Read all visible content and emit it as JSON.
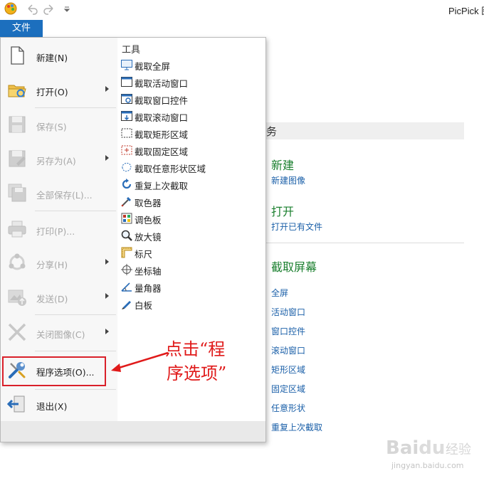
{
  "window": {
    "title": "PicPick 图"
  },
  "file_tab": {
    "label": "文件"
  },
  "menu": {
    "items": [
      {
        "label": "新建(N)",
        "enabled": true,
        "submenu": false,
        "icon": "new-file-icon"
      },
      {
        "label": "打开(O)",
        "enabled": true,
        "submenu": true,
        "icon": "open-folder-icon"
      },
      {
        "label": "保存(S)",
        "enabled": false,
        "submenu": false,
        "icon": "save-icon"
      },
      {
        "label": "另存为(A)",
        "enabled": false,
        "submenu": true,
        "icon": "save-as-icon"
      },
      {
        "label": "全部保存(L)...",
        "enabled": false,
        "submenu": false,
        "icon": "save-all-icon"
      },
      {
        "label": "打印(P)...",
        "enabled": false,
        "submenu": false,
        "icon": "print-icon"
      },
      {
        "label": "分享(H)",
        "enabled": false,
        "submenu": true,
        "icon": "share-icon"
      },
      {
        "label": "发送(D)",
        "enabled": false,
        "submenu": true,
        "icon": "send-icon"
      },
      {
        "label": "关闭图像(C)",
        "enabled": false,
        "submenu": true,
        "icon": "close-image-icon"
      },
      {
        "label": "程序选项(O)...",
        "enabled": true,
        "submenu": false,
        "icon": "wrench-icon"
      },
      {
        "label": "退出(X)",
        "enabled": true,
        "submenu": false,
        "icon": "exit-icon"
      }
    ]
  },
  "tools": {
    "title": "工具",
    "items": [
      {
        "label": "截取全屏",
        "icon": "monitor-icon"
      },
      {
        "label": "截取活动窗口",
        "icon": "window-icon"
      },
      {
        "label": "截取窗口控件",
        "icon": "window-control-icon"
      },
      {
        "label": "截取滚动窗口",
        "icon": "scroll-window-icon"
      },
      {
        "label": "截取矩形区域",
        "icon": "rectangle-region-icon"
      },
      {
        "label": "截取固定区域",
        "icon": "fixed-region-icon"
      },
      {
        "label": "截取任意形状区域",
        "icon": "freehand-region-icon"
      },
      {
        "label": "重复上次截取",
        "icon": "repeat-capture-icon"
      },
      {
        "label": "取色器",
        "icon": "eyedropper-icon"
      },
      {
        "label": "调色板",
        "icon": "palette-icon"
      },
      {
        "label": "放大镜",
        "icon": "magnifier-icon"
      },
      {
        "label": "标尺",
        "icon": "ruler-icon"
      },
      {
        "label": "坐标轴",
        "icon": "crosshair-icon"
      },
      {
        "label": "量角器",
        "icon": "protractor-icon"
      },
      {
        "label": "白板",
        "icon": "whiteboard-pen-icon"
      }
    ]
  },
  "start_page": {
    "header": "务",
    "new_title": "新建",
    "new_link": "新建图像",
    "open_title": "打开",
    "open_link": "打开已有文件",
    "capture_title": "截取屏幕",
    "capture_links": [
      "全屏",
      "活动窗口",
      "窗口控件",
      "滚动窗口",
      "矩形区域",
      "固定区域",
      "任意形状",
      "重复上次截取"
    ]
  },
  "annotation": {
    "line1": "点击“程",
    "line2": "序选项”"
  },
  "watermark": {
    "text": "Baidu 经验",
    "url": "jingyan.baidu.com"
  },
  "colors": {
    "accent": "#1c6fbe",
    "highlight_box": "#d9202a",
    "annotation": "#e01a1a",
    "section_title": "#1a7f2e",
    "link": "#1a5fa8"
  }
}
